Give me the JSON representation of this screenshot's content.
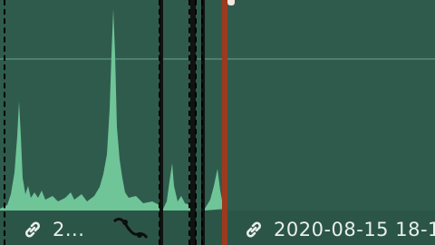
{
  "timeline": {
    "clips": [
      {
        "label": "2...",
        "icon": "link-icon",
        "waveform_color": "#6fc598"
      },
      {
        "label": "",
        "icon": "",
        "waveform_color": "#6fc598"
      },
      {
        "label": "",
        "icon": "",
        "waveform_color": "#6fc598"
      },
      {
        "label": "2020-08-15 18-1",
        "icon": "link-icon",
        "waveform_color": "#6fc598"
      }
    ],
    "fade_icon": "fade-curve-icon",
    "playhead_color": "#9b3a20",
    "clip_color": "#2f5b4d"
  }
}
